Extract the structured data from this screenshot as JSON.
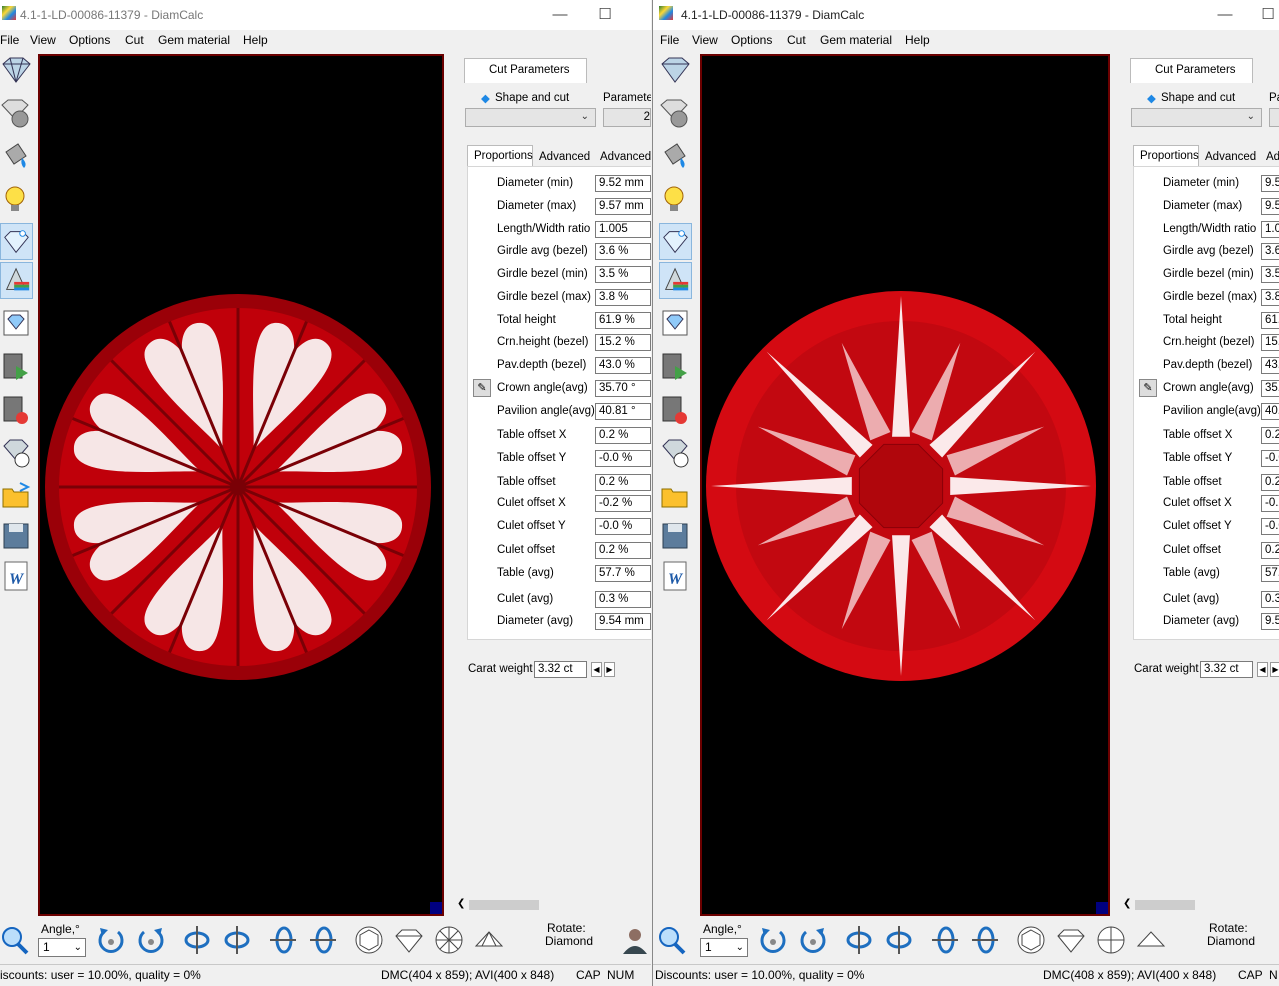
{
  "colors": {
    "viewport_bg": "#000000",
    "viewport_border": "#6b0000",
    "gem_red": "#c0000a",
    "heart_white": "#f6e6e6"
  },
  "left_window": {
    "title": "4.1-1-LD-00086-11379 - DiamCalc",
    "menu": [
      "File",
      "View",
      "Options",
      "Cut",
      "Gem material",
      "Help"
    ],
    "panel": {
      "top_tab": "Cut Parameters",
      "shape_label": "Shape and cut",
      "parameters_label": "Parameter",
      "parameters_value": "2",
      "sub_tabs": [
        "Proportions",
        "Advanced",
        "Advanced"
      ],
      "rows": [
        {
          "label": "Diameter (min)",
          "value": "9.52 mm"
        },
        {
          "label": "Diameter (max)",
          "value": "9.57 mm"
        },
        {
          "label": "Length/Width ratio",
          "value": "1.005"
        },
        {
          "label": "Girdle avg (bezel)",
          "value": "3.6 %"
        },
        {
          "label": "Girdle bezel (min)",
          "value": "3.5 %"
        },
        {
          "label": "Girdle bezel (max)",
          "value": "3.8 %"
        },
        {
          "label": "Total height",
          "value": "61.9 %"
        },
        {
          "label": "Crn.height (bezel)",
          "value": "15.2 %"
        },
        {
          "label": "Pav.depth (bezel)",
          "value": "43.0 %"
        },
        {
          "label": "Crown angle(avg)",
          "value": "35.70 °"
        },
        {
          "label": "Pavilion angle(avg)",
          "value": "40.81 °"
        },
        {
          "label": "Table offset X",
          "value": "0.2 %"
        },
        {
          "label": "Table offset Y",
          "value": "-0.0 %"
        },
        {
          "label": "Table offset",
          "value": "0.2 %"
        },
        {
          "label": "Culet offset X",
          "value": "-0.2 %"
        },
        {
          "label": "Culet offset Y",
          "value": "-0.0 %"
        },
        {
          "label": "Culet offset",
          "value": "0.2 %"
        },
        {
          "label": "Table (avg)",
          "value": "57.7 %"
        },
        {
          "label": "Culet (avg)",
          "value": "0.3 %"
        },
        {
          "label": "Diameter (avg)",
          "value": "9.54 mm"
        }
      ],
      "carat_label": "Carat weight",
      "carat_value": "3.32 ct"
    },
    "bottom": {
      "angle_label": "Angle,°",
      "angle_value": "1",
      "rotate_label": "Rotate:",
      "rotate_value": "Diamond"
    },
    "status": {
      "left": "iscounts: user = 10.00%, quality = 0%",
      "mid": "DMC(404 x 859); AVI(400 x 848)",
      "cap": "CAP",
      "num": "NUM"
    }
  },
  "right_window": {
    "title": "4.1-1-LD-00086-11379 - DiamCalc",
    "menu": [
      "File",
      "View",
      "Options",
      "Cut",
      "Gem material",
      "Help"
    ],
    "panel": {
      "top_tab": "Cut Parameters",
      "shape_label": "Shape and cut",
      "parameters_label": "Pa",
      "sub_tabs": [
        "Proportions",
        "Advanced",
        "Adv"
      ],
      "rows": [
        {
          "label": "Diameter (min)",
          "value": "9.5"
        },
        {
          "label": "Diameter (max)",
          "value": "9.5"
        },
        {
          "label": "Length/Width ratio",
          "value": "1.0"
        },
        {
          "label": "Girdle avg (bezel)",
          "value": "3.6"
        },
        {
          "label": "Girdle bezel (min)",
          "value": "3.5"
        },
        {
          "label": "Girdle bezel (max)",
          "value": "3.8"
        },
        {
          "label": "Total height",
          "value": "61."
        },
        {
          "label": "Crn.height (bezel)",
          "value": "15."
        },
        {
          "label": "Pav.depth (bezel)",
          "value": "43."
        },
        {
          "label": "Crown angle(avg)",
          "value": "35."
        },
        {
          "label": "Pavilion angle(avg)",
          "value": "40."
        },
        {
          "label": "Table offset X",
          "value": "0.2"
        },
        {
          "label": "Table offset Y",
          "value": "-0.0"
        },
        {
          "label": "Table offset",
          "value": "0.2"
        },
        {
          "label": "Culet offset X",
          "value": "-0.2"
        },
        {
          "label": "Culet offset Y",
          "value": "-0.0"
        },
        {
          "label": "Culet offset",
          "value": "0.2"
        },
        {
          "label": "Table (avg)",
          "value": "57."
        },
        {
          "label": "Culet (avg)",
          "value": "0.3"
        },
        {
          "label": "Diameter (avg)",
          "value": "9.5"
        }
      ],
      "carat_label": "Carat weight",
      "carat_value": "3.32 ct"
    },
    "bottom": {
      "angle_label": "Angle,°",
      "angle_value": "1",
      "rotate_label": "Rotate:",
      "rotate_value": "Diamond"
    },
    "status": {
      "left": "Discounts: user = 10.00%, quality = 0%",
      "mid": "DMC(408 x 859); AVI(400 x 848)",
      "cap": "CAP",
      "num": "N"
    }
  }
}
